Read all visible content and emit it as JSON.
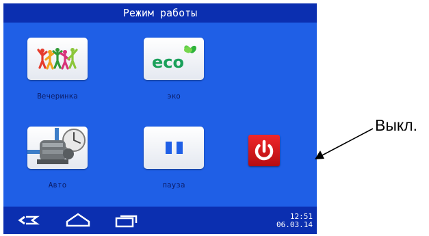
{
  "screen": {
    "title": "Режим работы",
    "background_color": "#1f5fe6",
    "bar_color": "#0b2fb0"
  },
  "tiles": [
    {
      "label": "Вечеринка",
      "icon": "party-people-icon"
    },
    {
      "label": "эко",
      "icon": "eco-leaf-icon",
      "logo_text": "eco"
    },
    {
      "label": "Авто",
      "icon": "pump-clock-icon"
    },
    {
      "label": "пауза",
      "icon": "pause-icon"
    }
  ],
  "power_button": {
    "icon": "power-icon",
    "color": "#d8181c"
  },
  "navbar": {
    "icons": [
      "back-icon",
      "home-icon",
      "recent-apps-icon"
    ],
    "time": "12:51",
    "date": "06.03.14"
  },
  "callout": {
    "label": "Выкл."
  }
}
